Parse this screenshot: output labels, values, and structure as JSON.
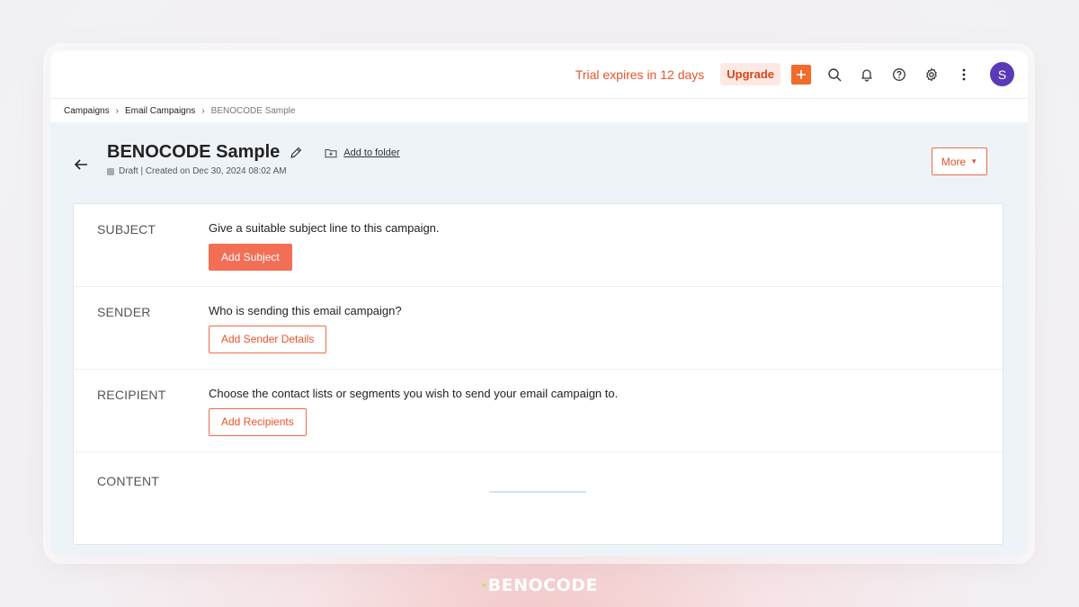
{
  "topbar": {
    "trial_text": "Trial expires in 12 days",
    "upgrade_label": "Upgrade",
    "avatar_initial": "S",
    "accent_color": "#f26a2c",
    "icons": [
      "plus-icon",
      "search-icon",
      "bell-icon",
      "help-icon",
      "gear-icon",
      "more-vertical-icon"
    ]
  },
  "breadcrumb": {
    "items": [
      "Campaigns",
      "Email Campaigns"
    ],
    "current": "BENOCODE Sample"
  },
  "header": {
    "title": "BENOCODE Sample",
    "add_to_folder": "Add to folder",
    "status_meta": "Draft | Created on Dec 30, 2024 08:02 AM",
    "more_label": "More"
  },
  "sections": {
    "subject": {
      "label": "SUBJECT",
      "description": "Give a suitable subject line to this campaign.",
      "button": "Add Subject"
    },
    "sender": {
      "label": "SENDER",
      "description": "Who is sending this email campaign?",
      "button": "Add Sender Details"
    },
    "recipient": {
      "label": "RECIPIENT",
      "description": "Choose the contact lists or segments you wish to send your email campaign to.",
      "button": "Add Recipients"
    },
    "content": {
      "label": "CONTENT"
    }
  },
  "watermark": {
    "brand": "BENOCODE"
  }
}
